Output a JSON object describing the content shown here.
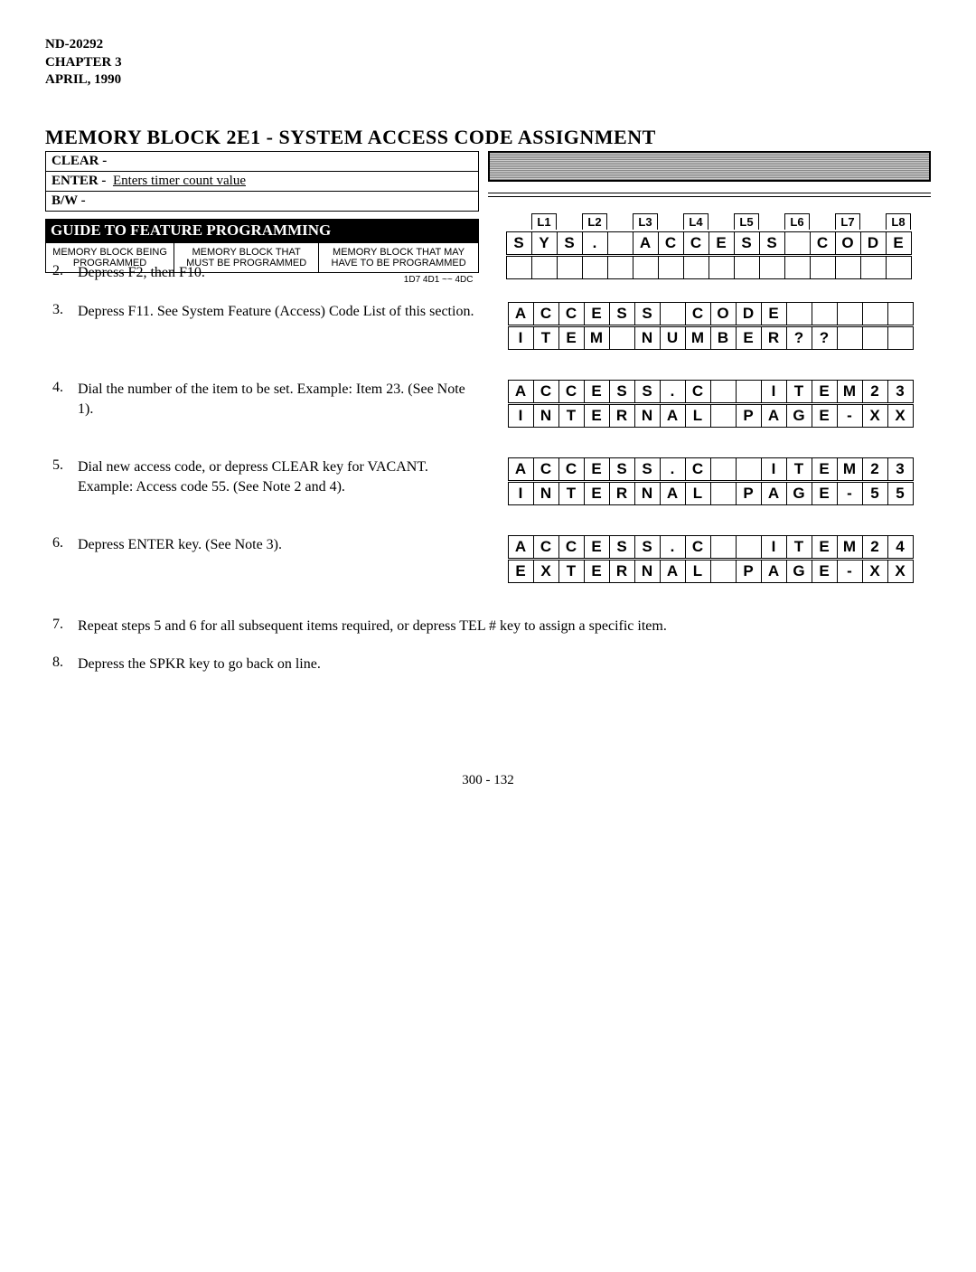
{
  "doc_id": "ND-20292",
  "chapter": "CHAPTER 3",
  "date": "APRIL, 1990",
  "title": "MEMORY BLOCK 2E1 - SYSTEM  ACCESS  CODE  ASSIGNMENT",
  "keys": {
    "clear": {
      "label": "CLEAR -",
      "value": ""
    },
    "enter": {
      "label": "ENTER -",
      "value": "Enters timer count value"
    },
    "bw": {
      "label": "B/W -",
      "value": ""
    }
  },
  "guide": {
    "title": "GUIDE TO FEATURE PROGRAMMING",
    "headers": [
      "MEMORY BLOCK BEING PROGRAMMED",
      "MEMORY BLOCK THAT MUST BE PROGRAMMED",
      "MEMORY BLOCK THAT MAY HAVE TO BE PROGRAMMED"
    ],
    "partial_row": "1D7  4D1 ~~ 4DC"
  },
  "sys_labels": [
    "",
    "L1",
    "",
    "L2",
    "",
    "L3",
    "",
    "L4",
    "",
    "L5",
    "",
    "L6",
    "",
    "L7",
    "",
    "L8"
  ],
  "sys_row": [
    "S",
    "Y",
    "S",
    ".",
    "",
    "A",
    "C",
    "C",
    "E",
    "S",
    "S",
    "",
    "C",
    "O",
    "D",
    "E"
  ],
  "steps": [
    {
      "num": "2.",
      "text": "Depress F2, then F10."
    },
    {
      "num": "3.",
      "text": "Depress F11.  See System Feature (Access) Code List of this section.",
      "rows": [
        [
          "A",
          "C",
          "C",
          "E",
          "S",
          "S",
          "",
          "C",
          "O",
          "D",
          "E",
          "",
          "",
          "",
          "",
          ""
        ],
        [
          "I",
          "T",
          "E",
          "M",
          "",
          "N",
          "U",
          "M",
          "B",
          "E",
          "R",
          "?",
          "?",
          "",
          "",
          ""
        ]
      ]
    },
    {
      "num": "4.",
      "text": "Dial the number of the item to be set. Example:  Item 23.  (See Note 1).",
      "rows": [
        [
          "A",
          "C",
          "C",
          "E",
          "S",
          "S",
          ".",
          "C",
          "",
          "",
          "I",
          "T",
          "E",
          "M",
          "2",
          "3"
        ],
        [
          "I",
          "N",
          "T",
          "E",
          "R",
          "N",
          "A",
          "L",
          "",
          "P",
          "A",
          "G",
          "E",
          "-",
          "X",
          "X"
        ]
      ]
    },
    {
      "num": "5.",
      "text": "Dial new access code, or depress CLEAR key for VACANT.\nExample:  Access code 55.  (See Note 2 and 4).",
      "rows": [
        [
          "A",
          "C",
          "C",
          "E",
          "S",
          "S",
          ".",
          "C",
          "",
          "",
          "I",
          "T",
          "E",
          "M",
          "2",
          "3"
        ],
        [
          "I",
          "N",
          "T",
          "E",
          "R",
          "N",
          "A",
          "L",
          "",
          "P",
          "A",
          "G",
          "E",
          "-",
          "5",
          "5"
        ]
      ]
    },
    {
      "num": "6.",
      "text": "Depress ENTER key.  (See Note 3).",
      "rows": [
        [
          "A",
          "C",
          "C",
          "E",
          "S",
          "S",
          ".",
          "C",
          "",
          "",
          "I",
          "T",
          "E",
          "M",
          "2",
          "4"
        ],
        [
          "E",
          "X",
          "T",
          "E",
          "R",
          "N",
          "A",
          "L",
          "",
          "P",
          "A",
          "G",
          "E",
          "-",
          "X",
          "X"
        ]
      ]
    }
  ],
  "footer_steps": [
    {
      "num": "7.",
      "text": "Repeat steps 5 and 6 for all subsequent items required, or depress TEL # key to assign a  specific item."
    },
    {
      "num": "8.",
      "text": "Depress  the SPKR  key to go back on line."
    }
  ],
  "page_num": "300 - 132"
}
